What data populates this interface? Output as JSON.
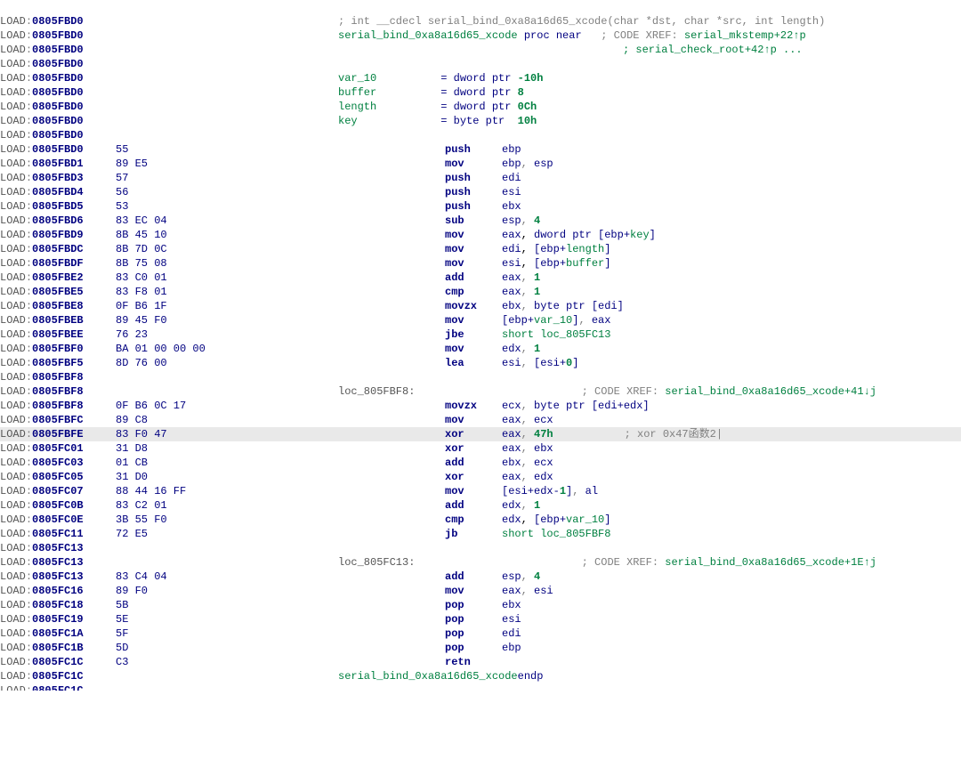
{
  "segment": "LOAD",
  "func_name": "serial_bind_0xa8a16d65_xcode",
  "signature_comment": "; int __cdecl serial_bind_0xa8a16d65_xcode(char *dst, char *src, int length)",
  "proc_near": "proc near",
  "endp": "endp",
  "xref_prefix": "; CODE XREF: ",
  "top_xrefs": [
    "serial_mkstemp+22↑p",
    "; serial_check_root+42↑p ..."
  ],
  "loc_xrefs": {
    "loc_805FBF8": "serial_bind_0xa8a16d65_xcode+41↓j",
    "loc_805FC13": "serial_bind_0xa8a16d65_xcode+1E↑j"
  },
  "vars": [
    {
      "name": "var_10",
      "decl": "= dword ptr -10h",
      "off": "-10h"
    },
    {
      "name": "buffer",
      "decl": "= dword ptr  8",
      "off": "8"
    },
    {
      "name": "length",
      "decl": "= dword ptr  0Ch",
      "off": "0Ch"
    },
    {
      "name": "key",
      "decl": "= byte ptr  10h",
      "off": "10h"
    }
  ],
  "highlight_addr": "0805FBFE",
  "highlight_comment": "; xor 0x47函数2",
  "lines": [
    {
      "addr": "0805FBD0",
      "kind": "sig"
    },
    {
      "addr": "0805FBD0",
      "kind": "proc"
    },
    {
      "addr": "0805FBD0",
      "kind": "xref2"
    },
    {
      "addr": "0805FBD0",
      "kind": "blank"
    },
    {
      "addr": "0805FBD0",
      "kind": "var",
      "vi": 0
    },
    {
      "addr": "0805FBD0",
      "kind": "var",
      "vi": 1
    },
    {
      "addr": "0805FBD0",
      "kind": "var",
      "vi": 2
    },
    {
      "addr": "0805FBD0",
      "kind": "var",
      "vi": 3
    },
    {
      "addr": "0805FBD0",
      "kind": "blank"
    },
    {
      "addr": "0805FBD0",
      "bytes": "55",
      "mnem": "push",
      "ops": [
        [
          "reg",
          "ebp"
        ]
      ]
    },
    {
      "addr": "0805FBD1",
      "bytes": "89 E5",
      "mnem": "mov",
      "ops": [
        [
          "reg",
          "ebp"
        ],
        [
          "reg",
          "esp"
        ]
      ]
    },
    {
      "addr": "0805FBD3",
      "bytes": "57",
      "mnem": "push",
      "ops": [
        [
          "reg",
          "edi"
        ]
      ]
    },
    {
      "addr": "0805FBD4",
      "bytes": "56",
      "mnem": "push",
      "ops": [
        [
          "reg",
          "esi"
        ]
      ]
    },
    {
      "addr": "0805FBD5",
      "bytes": "53",
      "mnem": "push",
      "ops": [
        [
          "reg",
          "ebx"
        ]
      ]
    },
    {
      "addr": "0805FBD6",
      "bytes": "83 EC 04",
      "mnem": "sub",
      "ops": [
        [
          "reg",
          "esp"
        ],
        [
          "num",
          "4"
        ]
      ]
    },
    {
      "addr": "0805FBD9",
      "bytes": "8B 45 10",
      "mnem": "mov",
      "ops": [
        [
          "reg",
          "eax"
        ],
        [
          "mem",
          "dword ptr [ebp+",
          "key",
          "]"
        ]
      ]
    },
    {
      "addr": "0805FBDC",
      "bytes": "8B 7D 0C",
      "mnem": "mov",
      "ops": [
        [
          "reg",
          "edi"
        ],
        [
          "mem",
          "[ebp+",
          "length",
          "]"
        ]
      ]
    },
    {
      "addr": "0805FBDF",
      "bytes": "8B 75 08",
      "mnem": "mov",
      "ops": [
        [
          "reg",
          "esi"
        ],
        [
          "mem",
          "[ebp+",
          "buffer",
          "]"
        ]
      ]
    },
    {
      "addr": "0805FBE2",
      "bytes": "83 C0 01",
      "mnem": "add",
      "ops": [
        [
          "reg",
          "eax"
        ],
        [
          "num",
          "1"
        ]
      ]
    },
    {
      "addr": "0805FBE5",
      "bytes": "83 F8 01",
      "mnem": "cmp",
      "ops": [
        [
          "reg",
          "eax"
        ],
        [
          "num",
          "1"
        ]
      ]
    },
    {
      "addr": "0805FBE8",
      "bytes": "0F B6 1F",
      "mnem": "movzx",
      "ops": [
        [
          "reg",
          "ebx"
        ],
        [
          "raw",
          "byte ptr [edi]"
        ]
      ]
    },
    {
      "addr": "0805FBEB",
      "bytes": "89 45 F0",
      "mnem": "mov",
      "ops": [
        [
          "mem",
          "[ebp+",
          "var_10",
          "]"
        ],
        [
          "reg",
          "eax"
        ]
      ]
    },
    {
      "addr": "0805FBEE",
      "bytes": "76 23",
      "mnem": "jbe",
      "ops": [
        [
          "lbl",
          "short loc_805FC13"
        ]
      ]
    },
    {
      "addr": "0805FBF0",
      "bytes": "BA 01 00 00 00",
      "mnem": "mov",
      "ops": [
        [
          "reg",
          "edx"
        ],
        [
          "num",
          "1"
        ]
      ]
    },
    {
      "addr": "0805FBF5",
      "bytes": "8D 76 00",
      "mnem": "lea",
      "ops": [
        [
          "reg",
          "esi"
        ],
        [
          "raw",
          "[esi+"
        ],
        [
          "num",
          "0"
        ],
        [
          "raw",
          "]"
        ]
      ]
    },
    {
      "addr": "0805FBF8",
      "kind": "blank"
    },
    {
      "addr": "0805FBF8",
      "kind": "loc",
      "label": "loc_805FBF8"
    },
    {
      "addr": "0805FBF8",
      "bytes": "0F B6 0C 17",
      "mnem": "movzx",
      "ops": [
        [
          "reg",
          "ecx"
        ],
        [
          "raw",
          "byte ptr [edi+edx]"
        ]
      ]
    },
    {
      "addr": "0805FBFC",
      "bytes": "89 C8",
      "mnem": "mov",
      "ops": [
        [
          "reg",
          "eax"
        ],
        [
          "reg",
          "ecx"
        ]
      ]
    },
    {
      "addr": "0805FBFE",
      "bytes": "83 F0 47",
      "mnem": "xor",
      "ops": [
        [
          "reg",
          "eax"
        ],
        [
          "num",
          "47h"
        ]
      ],
      "cmt": "highlight"
    },
    {
      "addr": "0805FC01",
      "bytes": "31 D8",
      "mnem": "xor",
      "ops": [
        [
          "reg",
          "eax"
        ],
        [
          "reg",
          "ebx"
        ]
      ]
    },
    {
      "addr": "0805FC03",
      "bytes": "01 CB",
      "mnem": "add",
      "ops": [
        [
          "reg",
          "ebx"
        ],
        [
          "reg",
          "ecx"
        ]
      ]
    },
    {
      "addr": "0805FC05",
      "bytes": "31 D0",
      "mnem": "xor",
      "ops": [
        [
          "reg",
          "eax"
        ],
        [
          "reg",
          "edx"
        ]
      ]
    },
    {
      "addr": "0805FC07",
      "bytes": "88 44 16 FF",
      "mnem": "mov",
      "ops": [
        [
          "raw",
          "[esi+edx-"
        ],
        [
          "num",
          "1"
        ],
        [
          "raw",
          "]"
        ],
        [
          "reg",
          "al"
        ]
      ]
    },
    {
      "addr": "0805FC0B",
      "bytes": "83 C2 01",
      "mnem": "add",
      "ops": [
        [
          "reg",
          "edx"
        ],
        [
          "num",
          "1"
        ]
      ]
    },
    {
      "addr": "0805FC0E",
      "bytes": "3B 55 F0",
      "mnem": "cmp",
      "ops": [
        [
          "reg",
          "edx"
        ],
        [
          "mem",
          "[ebp+",
          "var_10",
          "]"
        ]
      ]
    },
    {
      "addr": "0805FC11",
      "bytes": "72 E5",
      "mnem": "jb",
      "ops": [
        [
          "lbl",
          "short loc_805FBF8"
        ]
      ]
    },
    {
      "addr": "0805FC13",
      "kind": "blank"
    },
    {
      "addr": "0805FC13",
      "kind": "loc",
      "label": "loc_805FC13"
    },
    {
      "addr": "0805FC13",
      "bytes": "83 C4 04",
      "mnem": "add",
      "ops": [
        [
          "reg",
          "esp"
        ],
        [
          "num",
          "4"
        ]
      ]
    },
    {
      "addr": "0805FC16",
      "bytes": "89 F0",
      "mnem": "mov",
      "ops": [
        [
          "reg",
          "eax"
        ],
        [
          "reg",
          "esi"
        ]
      ]
    },
    {
      "addr": "0805FC18",
      "bytes": "5B",
      "mnem": "pop",
      "ops": [
        [
          "reg",
          "ebx"
        ]
      ]
    },
    {
      "addr": "0805FC19",
      "bytes": "5E",
      "mnem": "pop",
      "ops": [
        [
          "reg",
          "esi"
        ]
      ]
    },
    {
      "addr": "0805FC1A",
      "bytes": "5F",
      "mnem": "pop",
      "ops": [
        [
          "reg",
          "edi"
        ]
      ]
    },
    {
      "addr": "0805FC1B",
      "bytes": "5D",
      "mnem": "pop",
      "ops": [
        [
          "reg",
          "ebp"
        ]
      ]
    },
    {
      "addr": "0805FC1C",
      "bytes": "C3",
      "mnem": "retn",
      "ops": []
    },
    {
      "addr": "0805FC1C",
      "kind": "endp"
    },
    {
      "addr": "0805FC1C",
      "kind": "blank"
    }
  ]
}
